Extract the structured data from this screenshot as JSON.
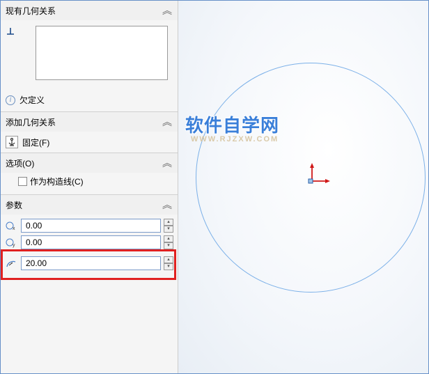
{
  "sections": {
    "existing_relations": {
      "title": "现有几何关系"
    },
    "status": {
      "label": "欠定义"
    },
    "add_relations": {
      "title": "添加几何关系",
      "fixed_label": "固定(F)"
    },
    "options": {
      "title": "选项(O)",
      "construction_label": "作为构造线(C)"
    },
    "params": {
      "title": "参数",
      "cx": "0.00",
      "cy": "0.00",
      "radius": "20.00"
    }
  },
  "watermark": {
    "main": "软件自学网",
    "sub": "WWW.RJZXW.COM"
  }
}
